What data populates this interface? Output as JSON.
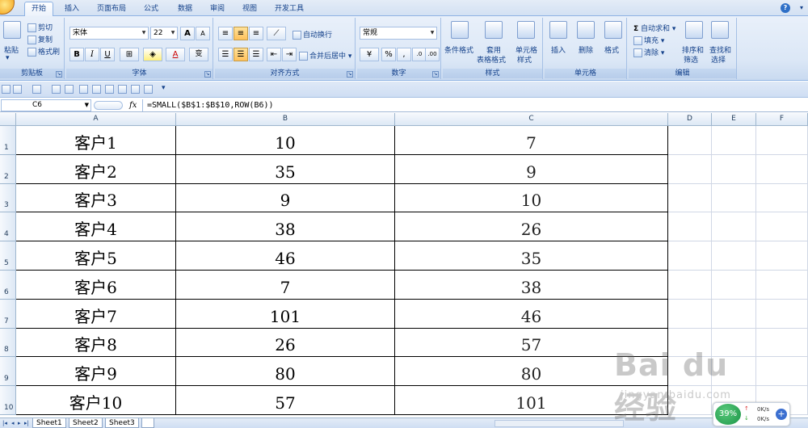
{
  "ribbon_tabs": [
    "开始",
    "插入",
    "页面布局",
    "公式",
    "数据",
    "审阅",
    "视图",
    "开发工具"
  ],
  "active_tab": "开始",
  "clipboard": {
    "paste": "粘贴",
    "cut": "剪切",
    "copy": "复制",
    "format_painter": "格式刷",
    "label": "剪贴板"
  },
  "font": {
    "name": "宋体",
    "size": "22",
    "grow": "A",
    "shrink": "A",
    "bold": "B",
    "italic": "I",
    "underline": "U",
    "font_color": "A",
    "phonetic": "变",
    "label": "字体"
  },
  "alignment": {
    "wrap_text": "自动换行",
    "merge_center": "合并后居中",
    "label": "对齐方式"
  },
  "number": {
    "format": "常规",
    "percent": "%",
    "comma": ",",
    "label": "数字"
  },
  "styles": {
    "conditional": "条件格式",
    "table_format_1": "套用",
    "table_format_2": "表格格式",
    "cell_styles_1": "单元格",
    "cell_styles_2": "样式",
    "label": "样式"
  },
  "cells": {
    "insert": "插入",
    "delete": "删除",
    "format": "格式",
    "label": "单元格"
  },
  "editing": {
    "autosum": "自动求和",
    "fill": "填充",
    "clear": "清除",
    "sort_1": "排序和",
    "sort_2": "筛选",
    "find_1": "查找和",
    "find_2": "选择",
    "label": "编辑"
  },
  "help": "?",
  "formula_bar": {
    "name_box": "C6",
    "fx": "fx",
    "formula": "=SMALL($B$1:$B$10,ROW(B6))"
  },
  "columns": [
    "A",
    "B",
    "C",
    "D",
    "E",
    "F"
  ],
  "rows": [
    {
      "num": "1",
      "a": "客户1",
      "b": "10",
      "c": "7"
    },
    {
      "num": "2",
      "a": "客户2",
      "b": "35",
      "c": "9"
    },
    {
      "num": "3",
      "a": "客户3",
      "b": "9",
      "c": "10"
    },
    {
      "num": "4",
      "a": "客户4",
      "b": "38",
      "c": "26"
    },
    {
      "num": "5",
      "a": "客户5",
      "b": "46",
      "c": "35"
    },
    {
      "num": "6",
      "a": "客户6",
      "b": "7",
      "c": "38"
    },
    {
      "num": "7",
      "a": "客户7",
      "b": "101",
      "c": "46"
    },
    {
      "num": "8",
      "a": "客户8",
      "b": "26",
      "c": "57"
    },
    {
      "num": "9",
      "a": "客户9",
      "b": "80",
      "c": "80"
    },
    {
      "num": "10",
      "a": "客户10",
      "b": "57",
      "c": "101"
    }
  ],
  "sheets": [
    "Sheet1",
    "Sheet2",
    "Sheet3"
  ],
  "active_sheet": "Sheet2",
  "net_widget": {
    "percent": "39%",
    "up": "0K/s",
    "down": "0K/s"
  },
  "watermark": {
    "logo": "Bai du 经验",
    "site": "jingyan.baidu.com"
  }
}
